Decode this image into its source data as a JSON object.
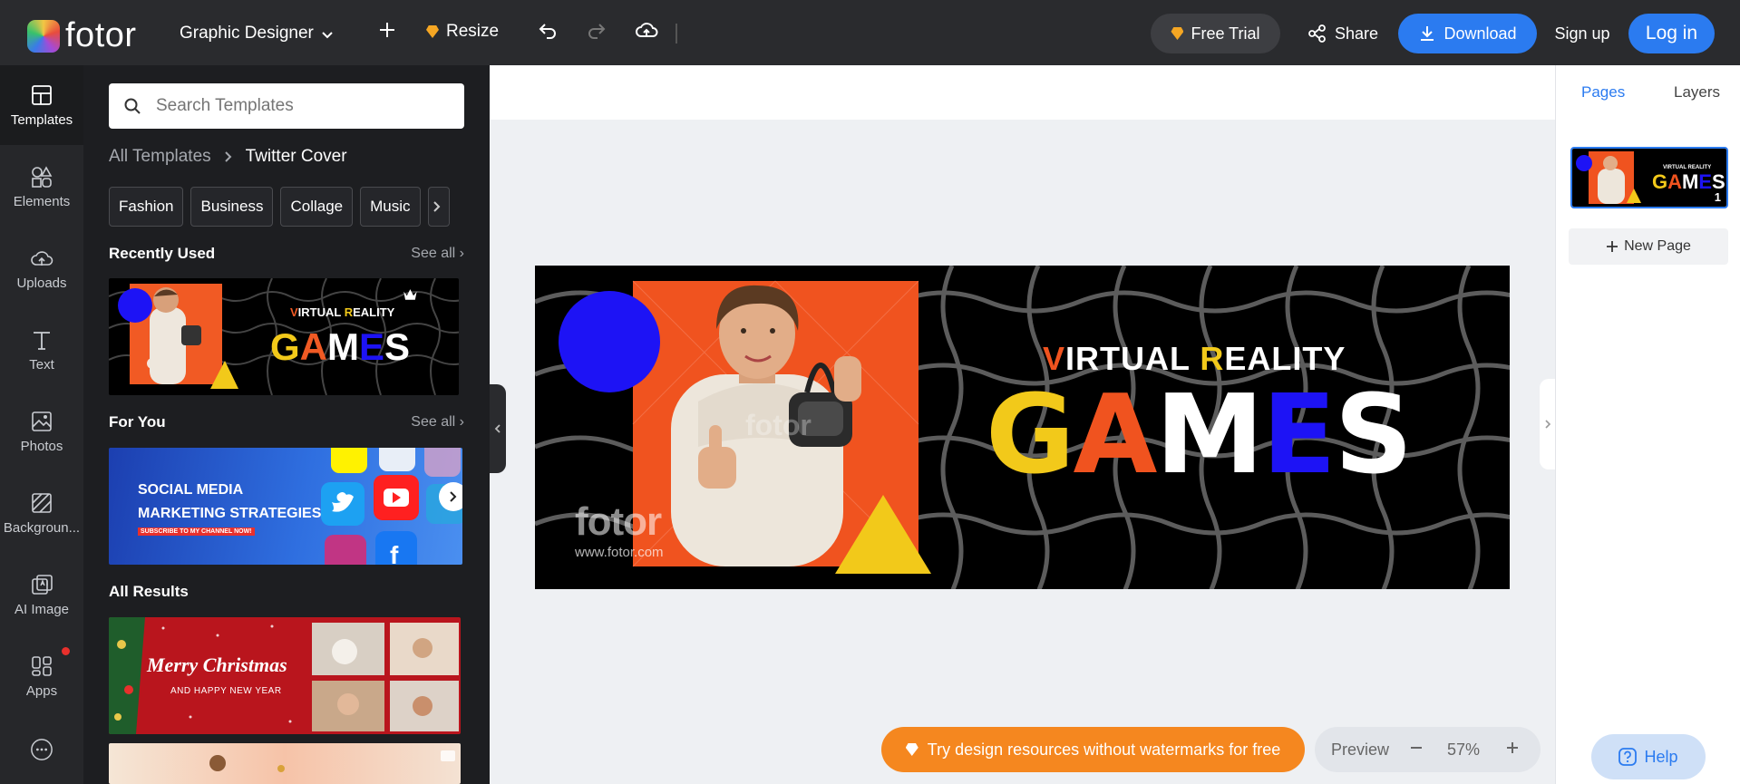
{
  "header": {
    "logo": "fotor",
    "workspace": "Graphic Designer",
    "resize": "Resize",
    "free_trial": "Free Trial",
    "share": "Share",
    "download": "Download",
    "signup": "Sign up",
    "login": "Log in"
  },
  "rail": [
    {
      "label": "Templates",
      "icon": "templates-icon"
    },
    {
      "label": "Elements",
      "icon": "elements-icon"
    },
    {
      "label": "Uploads",
      "icon": "upload-cloud-icon"
    },
    {
      "label": "Text",
      "icon": "text-icon"
    },
    {
      "label": "Photos",
      "icon": "photos-icon"
    },
    {
      "label": "Backgroun...",
      "icon": "background-icon"
    },
    {
      "label": "AI Image",
      "icon": "ai-image-icon"
    },
    {
      "label": "Apps",
      "icon": "apps-icon"
    }
  ],
  "panel": {
    "search_placeholder": "Search Templates",
    "breadcrumb_root": "All Templates",
    "breadcrumb_current": "Twitter Cover",
    "chips": [
      "Fashion",
      "Business",
      "Collage",
      "Music"
    ],
    "recently_used": "Recently Used",
    "for_you": "For You",
    "all_results": "All Results",
    "see_all": "See all",
    "social_title_1": "SOCIAL MEDIA",
    "social_title_2": "MARKETING STRATEGIES",
    "social_sub": "SUBSCRIBE TO MY CHANNEL NOW!",
    "xmas_title": "Merry Christmas",
    "xmas_sub": "AND HAPPY NEW YEAR"
  },
  "design": {
    "line1_v": "V",
    "line1_irtual": "IRTUAL ",
    "line1_r": "R",
    "line1_eality": "EALITY",
    "g": "G",
    "a": "A",
    "m": "M",
    "e": "E",
    "s": "S",
    "watermark": "fotor",
    "watermark_url": "www.fotor.com"
  },
  "right_panel": {
    "pages_tab": "Pages",
    "layers_tab": "Layers",
    "page_number": "1",
    "new_page": "New Page"
  },
  "bottom": {
    "promo": "Try design resources without watermarks for free",
    "preview": "Preview",
    "zoom": "57%",
    "help": "Help"
  },
  "colors": {
    "accent": "#2b7bf0",
    "yellow": "#f2c91a",
    "orange": "#f0531f",
    "blue_circle": "#1d13f5"
  }
}
